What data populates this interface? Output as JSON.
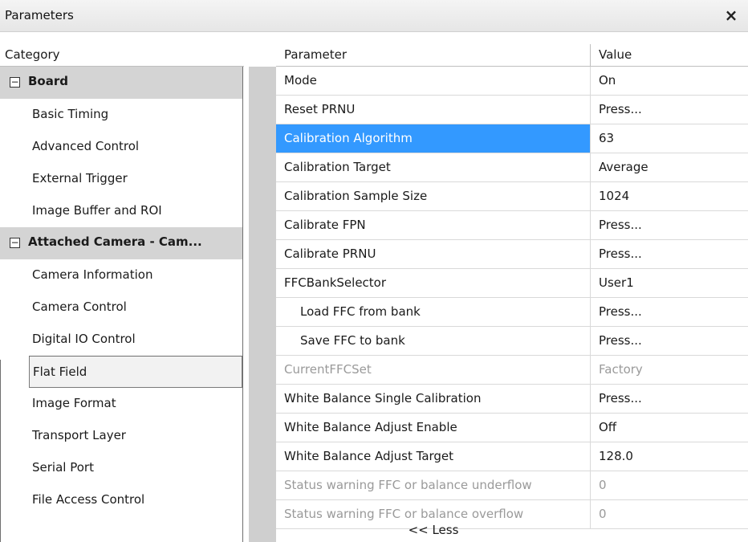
{
  "window": {
    "title": "Parameters",
    "close_label": "×"
  },
  "category": {
    "header": "Category",
    "items": [
      {
        "label": "Board",
        "group": true,
        "expander": "−"
      },
      {
        "label": "Basic Timing"
      },
      {
        "label": "Advanced Control"
      },
      {
        "label": "External Trigger"
      },
      {
        "label": "Image Buffer and ROI"
      },
      {
        "label": "Attached Camera - Cam...",
        "group": true,
        "expander": "−"
      },
      {
        "label": "Camera Information"
      },
      {
        "label": "Camera Control"
      },
      {
        "label": "Digital IO Control"
      },
      {
        "label": "Flat Field",
        "selected": true
      },
      {
        "label": "Image Format"
      },
      {
        "label": "Transport Layer"
      },
      {
        "label": "Serial Port"
      },
      {
        "label": "File Access Control"
      }
    ]
  },
  "grid": {
    "header_param": "Parameter",
    "header_value": "Value",
    "rows": [
      {
        "param": "Mode",
        "value": "On"
      },
      {
        "param": "Reset PRNU",
        "value": "Press..."
      },
      {
        "param": "Calibration Algorithm",
        "value": "63",
        "highlight": true
      },
      {
        "param": "Calibration Target",
        "value": "Average"
      },
      {
        "param": "Calibration Sample Size",
        "value": "1024"
      },
      {
        "param": "Calibrate FPN",
        "value": "Press..."
      },
      {
        "param": "Calibrate PRNU",
        "value": "Press..."
      },
      {
        "param": "FFCBankSelector",
        "value": "User1"
      },
      {
        "param": "Load FFC from bank",
        "value": "Press...",
        "indent": true
      },
      {
        "param": "Save FFC to bank",
        "value": "Press...",
        "indent": true
      },
      {
        "param": "CurrentFFCSet",
        "value": "Factory",
        "disabled": true
      },
      {
        "param": "White Balance Single Calibration",
        "value": "Press..."
      },
      {
        "param": "White Balance Adjust Enable",
        "value": "Off"
      },
      {
        "param": "White Balance Adjust Target",
        "value": "128.0"
      },
      {
        "param": "Status warning FFC or balance underflow",
        "value": "0",
        "disabled": true
      },
      {
        "param": "Status warning FFC or balance overflow",
        "value": "0",
        "disabled": true
      }
    ],
    "less_label": "<< Less"
  },
  "colors": {
    "selection": "#3399ff",
    "group_bg": "#d4d4d4",
    "disabled_text": "#9a9a9a"
  }
}
